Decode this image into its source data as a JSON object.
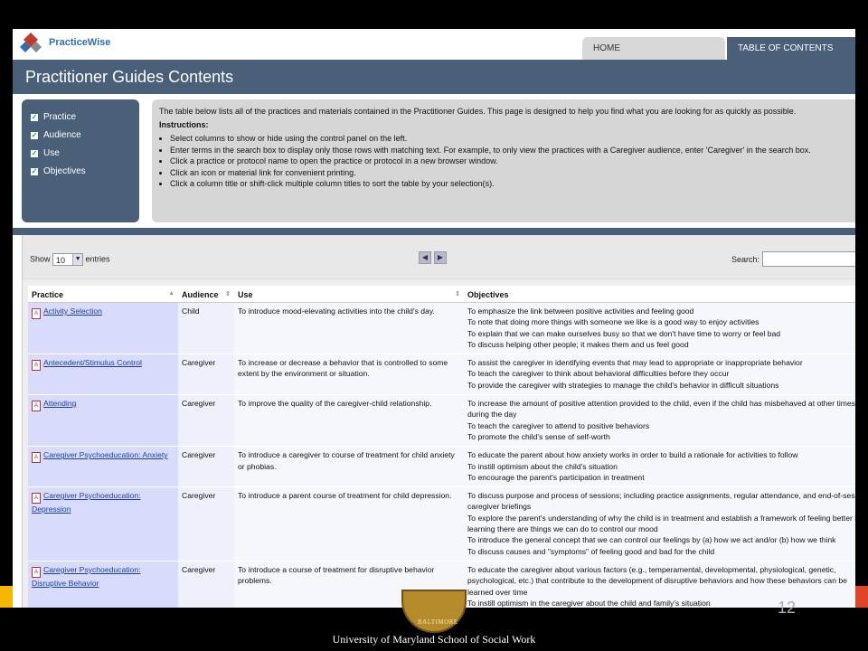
{
  "brand": {
    "logo_text": "PracticeWise"
  },
  "nav": {
    "tabs": [
      {
        "label": "HOME"
      },
      {
        "label": "TABLE OF CONTENTS"
      }
    ]
  },
  "page_title": "Practitioner Guides Contents",
  "controls": {
    "items": [
      "Practice",
      "Audience",
      "Use",
      "Objectives"
    ]
  },
  "instructions": {
    "intro": "The table below lists all of the practices and materials contained in the Practitioner Guides. This page is designed to help you find what you are looking for as quickly as possible.",
    "heading": "Instructions:",
    "bullets": [
      "Select columns to show or hide using the control panel on the left.",
      "Enter terms in the search box to display only those rows with matching text. For example, to only view the practices with a Caregiver audience, enter 'Caregiver' in the search box.",
      "Click a practice or protocol name to open the practice or protocol in a new browser window.",
      "Click an icon or material link for convenient printing.",
      "Click a column title or shift-click multiple column titles to sort the table by your selection(s)."
    ]
  },
  "table_controls": {
    "show_label": "Show",
    "entries_value": "10",
    "entries_label": "entries",
    "search_label": "Search:"
  },
  "table": {
    "columns": [
      "Practice",
      "Audience",
      "Use",
      "Objectives"
    ],
    "rows": [
      {
        "practice": "Activity Selection",
        "audience": "Child",
        "use": "To introduce mood-elevating activities into the child's day.",
        "objectives": "To emphasize the link between positive activities and feeling good\nTo note that doing more things with someone we like is a good way to enjoy activities\nTo explain that we can make ourselves busy so that we don't have time to worry or feel bad\nTo discuss helping other people; it makes them and us feel good"
      },
      {
        "practice": "Antecedent/Stimulus Control",
        "audience": "Caregiver",
        "use": "To increase or decrease a behavior that is controlled to some extent by the environment or situation.",
        "objectives": "To assist the caregiver in identifying events that may lead to appropriate or inappropriate behavior\nTo teach the caregiver to think about behavioral difficulties before they occur\nTo provide the caregiver with strategies to manage the child's behavior in difficult situations"
      },
      {
        "practice": "Attending",
        "audience": "Caregiver",
        "use": "To improve the quality of the caregiver-child relationship.",
        "objectives": "To increase the amount of positive attention provided to the child, even if the child has misbehaved at other times during the day\nTo teach the caregiver to attend to positive behaviors\nTo promote the child's sense of self-worth"
      },
      {
        "practice": "Caregiver Psychoeducation: Anxiety",
        "audience": "Caregiver",
        "use": "To introduce a caregiver to course of treatment for child anxiety or phobias.",
        "objectives": "To educate the parent about how anxiety works in order to build a rationale for activities to follow\nTo instill optimism about the child's situation\nTo encourage the parent's participation in treatment"
      },
      {
        "practice": "Caregiver Psychoeducation: Depression",
        "audience": "Caregiver",
        "use": "To introduce a parent course of treatment for child depression.",
        "objectives": "To discuss purpose and process of sessions; including practice assignments, regular attendance, and end-of-session caregiver briefings\nTo explore the parent's understanding of why the child is in treatment and establish a framework of feeling better by learning there are things we can do to control our mood\nTo introduce the general concept that we can control our feelings by (a) how we act and/or (b) how we think\nTo discuss causes and \"symptoms\" of feeling good and bad for the child"
      },
      {
        "practice": "Caregiver Psychoeducation: Disruptive Behavior",
        "audience": "Caregiver",
        "use": "To introduce a course of treatment for disruptive behavior problems.",
        "objectives": "To educate the caregiver about various factors (e.g., temperamental, developmental, physiological, genetic, psychological, etc.) that contribute to the development of disruptive behaviors and how these behaviors can be learned over time\nTo instill optimism in the caregiver about the child and family's situation"
      }
    ]
  },
  "slide": {
    "page_number": "12",
    "footer": "University of Maryland School of Social Work",
    "seal_text": "BALTIMORE"
  },
  "colors": {
    "header_bg": "#4a5f78",
    "practice_col": "#d8dcfa",
    "accent_yellow": "#f5b800",
    "accent_red": "#e0452a"
  }
}
